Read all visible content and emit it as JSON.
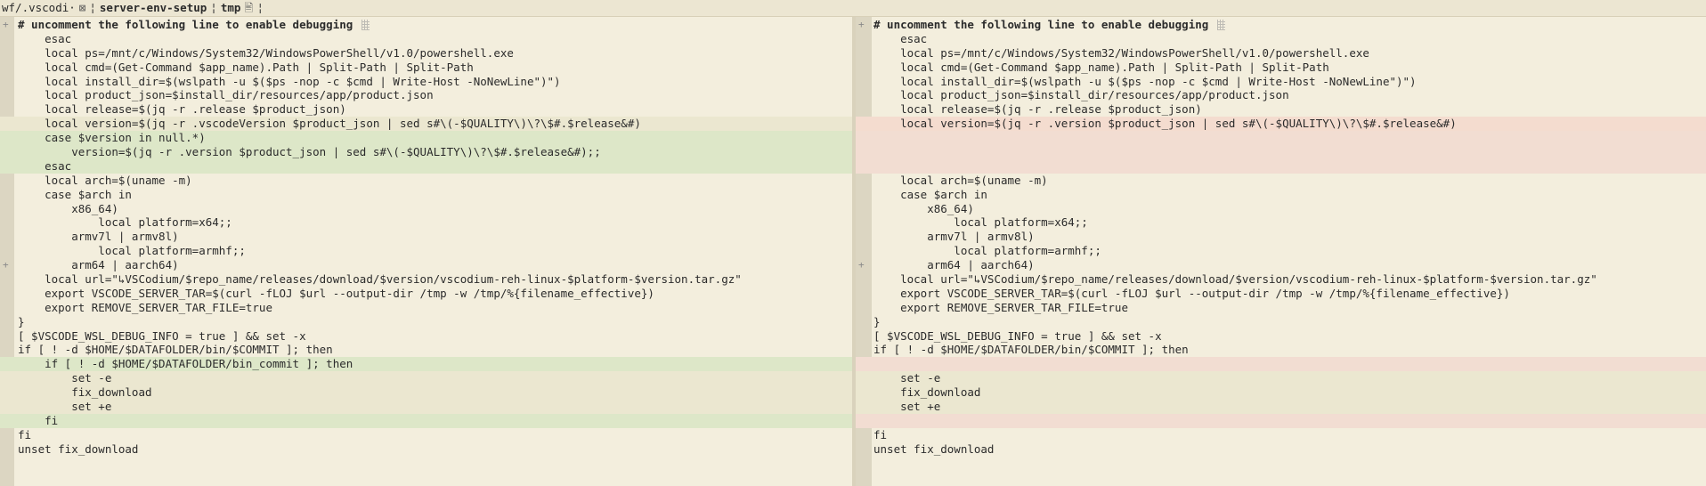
{
  "statusbar": {
    "path": "wf/.vscodi·",
    "branch": "server-env-setup",
    "tmp_label": "tmp",
    "glyph_a": "⊠",
    "glyph_b": "¦",
    "glyph_c": "🖹"
  },
  "left": {
    "lines": [
      {
        "type": "heading",
        "mark": "+",
        "text": "# uncomment the following line to enable debugging"
      },
      {
        "type": "normal",
        "mark": "",
        "text": "    esac"
      },
      {
        "type": "normal",
        "mark": "",
        "text": "    local ps=/mnt/c/Windows/System32/WindowsPowerShell/v1.0/powershell.exe"
      },
      {
        "type": "normal",
        "mark": "",
        "text": "    local cmd=(Get-Command $app_name).Path | Split-Path | Split-Path"
      },
      {
        "type": "normal",
        "mark": "",
        "text": "    local install_dir=$(wslpath -u $($ps -nop -c $cmd | Write-Host -NoNewLine\")\")"
      },
      {
        "type": "normal",
        "mark": "",
        "text": "    local product_json=$install_dir/resources/app/product.json"
      },
      {
        "type": "normal",
        "mark": "",
        "text": "    local release=$(jq -r .release $product_json)"
      },
      {
        "type": "change",
        "mark": "",
        "text": "    local version=$(jq -r .vscodeVersion $product_json | sed s#\\(-$QUALITY\\)\\?\\$#.$release&#)"
      },
      {
        "type": "add",
        "mark": "",
        "text": "    case $version in null.*)"
      },
      {
        "type": "add",
        "mark": "",
        "text": "        version=$(jq -r .version $product_json | sed s#\\(-$QUALITY\\)\\?\\$#.$release&#);;"
      },
      {
        "type": "add",
        "mark": "",
        "text": "    esac"
      },
      {
        "type": "normal",
        "mark": "",
        "text": "    local arch=$(uname -m)"
      },
      {
        "type": "normal",
        "mark": "",
        "text": "    case $arch in"
      },
      {
        "type": "normal",
        "mark": "",
        "text": "        x86_64)"
      },
      {
        "type": "normal",
        "mark": "",
        "text": "            local platform=x64;;"
      },
      {
        "type": "normal",
        "mark": "",
        "text": "        armv7l | armv8l)"
      },
      {
        "type": "normal",
        "mark": "",
        "text": "            local platform=armhf;;"
      },
      {
        "type": "normal",
        "mark": "+",
        "text": "        arm64 | aarch64)"
      },
      {
        "type": "normal",
        "mark": "",
        "text": "    local url=\"↳VSCodium/$repo_name/releases/download/$version/vscodium-reh-linux-$platform-$version.tar.gz\""
      },
      {
        "type": "normal",
        "mark": "",
        "text": "    export VSCODE_SERVER_TAR=$(curl -fLOJ $url --output-dir /tmp -w /tmp/%{filename_effective})"
      },
      {
        "type": "normal",
        "mark": "",
        "text": "    export REMOVE_SERVER_TAR_FILE=true"
      },
      {
        "type": "normal",
        "mark": "",
        "text": "}"
      },
      {
        "type": "normal",
        "mark": "",
        "text": "[ $VSCODE_WSL_DEBUG_INFO = true ] && set -x"
      },
      {
        "type": "normal",
        "mark": "",
        "text": "if [ ! -d $HOME/$DATAFOLDER/bin/$COMMIT ]; then"
      },
      {
        "type": "add",
        "mark": "",
        "text": "    if [ ! -d $HOME/$DATAFOLDER/bin_commit ]; then"
      },
      {
        "type": "change",
        "mark": "",
        "text": "        set -e"
      },
      {
        "type": "change",
        "mark": "",
        "text": "        fix_download"
      },
      {
        "type": "change",
        "mark": "",
        "text": "        set +e"
      },
      {
        "type": "add",
        "mark": "",
        "text": "    fi"
      },
      {
        "type": "normal",
        "mark": "",
        "text": "fi"
      },
      {
        "type": "normal",
        "mark": "",
        "text": "unset fix_download"
      }
    ]
  },
  "right": {
    "lines": [
      {
        "type": "heading",
        "mark": "+",
        "text": "# uncomment the following line to enable debugging"
      },
      {
        "type": "normal",
        "mark": "",
        "text": "    esac"
      },
      {
        "type": "normal",
        "mark": "",
        "text": "    local ps=/mnt/c/Windows/System32/WindowsPowerShell/v1.0/powershell.exe"
      },
      {
        "type": "normal",
        "mark": "",
        "text": "    local cmd=(Get-Command $app_name).Path | Split-Path | Split-Path"
      },
      {
        "type": "normal",
        "mark": "",
        "text": "    local install_dir=$(wslpath -u $($ps -nop -c $cmd | Write-Host -NoNewLine\")\")"
      },
      {
        "type": "normal",
        "mark": "",
        "text": "    local product_json=$install_dir/resources/app/product.json"
      },
      {
        "type": "normal",
        "mark": "",
        "text": "    local release=$(jq -r .release $product_json)"
      },
      {
        "type": "del",
        "mark": "",
        "text": "    local version=$(jq -r .version $product_json | sed s#\\(-$QUALITY\\)\\?\\$#.$release&#)"
      },
      {
        "type": "filler",
        "mark": "",
        "text": ""
      },
      {
        "type": "filler",
        "mark": "",
        "text": ""
      },
      {
        "type": "filler",
        "mark": "",
        "text": ""
      },
      {
        "type": "normal",
        "mark": "",
        "text": "    local arch=$(uname -m)"
      },
      {
        "type": "normal",
        "mark": "",
        "text": "    case $arch in"
      },
      {
        "type": "normal",
        "mark": "",
        "text": "        x86_64)"
      },
      {
        "type": "normal",
        "mark": "",
        "text": "            local platform=x64;;"
      },
      {
        "type": "normal",
        "mark": "",
        "text": "        armv7l | armv8l)"
      },
      {
        "type": "normal",
        "mark": "",
        "text": "            local platform=armhf;;"
      },
      {
        "type": "normal",
        "mark": "+",
        "text": "        arm64 | aarch64)"
      },
      {
        "type": "normal",
        "mark": "",
        "text": "    local url=\"↳VSCodium/$repo_name/releases/download/$version/vscodium-reh-linux-$platform-$version.tar.gz\""
      },
      {
        "type": "normal",
        "mark": "",
        "text": "    export VSCODE_SERVER_TAR=$(curl -fLOJ $url --output-dir /tmp -w /tmp/%{filename_effective})"
      },
      {
        "type": "normal",
        "mark": "",
        "text": "    export REMOVE_SERVER_TAR_FILE=true"
      },
      {
        "type": "normal",
        "mark": "",
        "text": "}"
      },
      {
        "type": "normal",
        "mark": "",
        "text": "[ $VSCODE_WSL_DEBUG_INFO = true ] && set -x"
      },
      {
        "type": "normal",
        "mark": "",
        "text": "if [ ! -d $HOME/$DATAFOLDER/bin/$COMMIT ]; then"
      },
      {
        "type": "filler",
        "mark": "",
        "text": ""
      },
      {
        "type": "change",
        "mark": "",
        "text": "    set -e"
      },
      {
        "type": "change",
        "mark": "",
        "text": "    fix_download"
      },
      {
        "type": "change",
        "mark": "",
        "text": "    set +e"
      },
      {
        "type": "filler",
        "mark": "",
        "text": ""
      },
      {
        "type": "normal",
        "mark": "",
        "text": "fi"
      },
      {
        "type": "normal",
        "mark": "",
        "text": "unset fix_download"
      }
    ]
  }
}
